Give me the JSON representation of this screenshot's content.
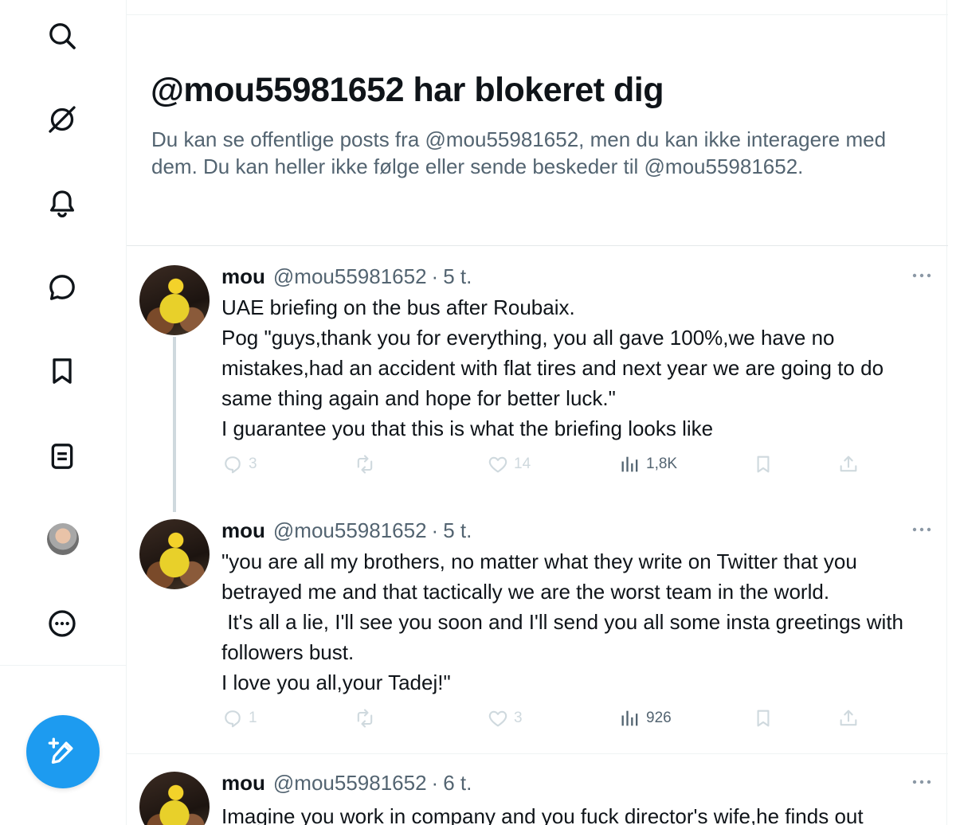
{
  "sidebar": {
    "icons": [
      "search-icon",
      "grok-icon",
      "bell-icon",
      "message-icon",
      "bookmark-icon",
      "list-icon",
      "avatar",
      "more-icon"
    ],
    "compose_color": "#1d9bf0"
  },
  "blocked": {
    "title": "@mou55981652 har blokeret dig",
    "text": "Du kan se offentlige posts fra @mou55981652, men du kan ikke interagere med dem. Du kan heller ikke følge eller sende beskeder til @mou55981652."
  },
  "tweets": [
    {
      "name": "mou",
      "handle": "@mou55981652",
      "dot": "·",
      "time": "5 t.",
      "text": "UAE briefing on the bus after Roubaix.\nPog \"guys,thank you for everything, you all gave 100%,we have no mistakes,had an accident with flat tires and next year we are going to do same thing again and hope for better luck.\"\nI guarantee you that this is what the briefing looks like",
      "replies": "3",
      "reposts": "",
      "likes": "14",
      "views": "1,8K"
    },
    {
      "name": "mou",
      "handle": "@mou55981652",
      "dot": "·",
      "time": "5 t.",
      "text": "\"you are all my brothers, no matter what they write on Twitter that you betrayed me and that tactically we are the worst team in the world.\n It's all a lie, I'll see you soon and I'll send you all some insta greetings with followers bust.\nI love you all,your Tadej!\"",
      "replies": "1",
      "reposts": "",
      "likes": "3",
      "views": "926"
    },
    {
      "name": "mou",
      "handle": "@mou55981652",
      "dot": "·",
      "time": "6 t.",
      "text": "Imagine you work in company and you fuck director's wife,he finds out"
    }
  ],
  "colors": {
    "text": "#0f1419",
    "secondary": "#536471",
    "action_disabled": "#cfd9de",
    "border": "#eff3f4",
    "accent": "#1d9bf0"
  }
}
